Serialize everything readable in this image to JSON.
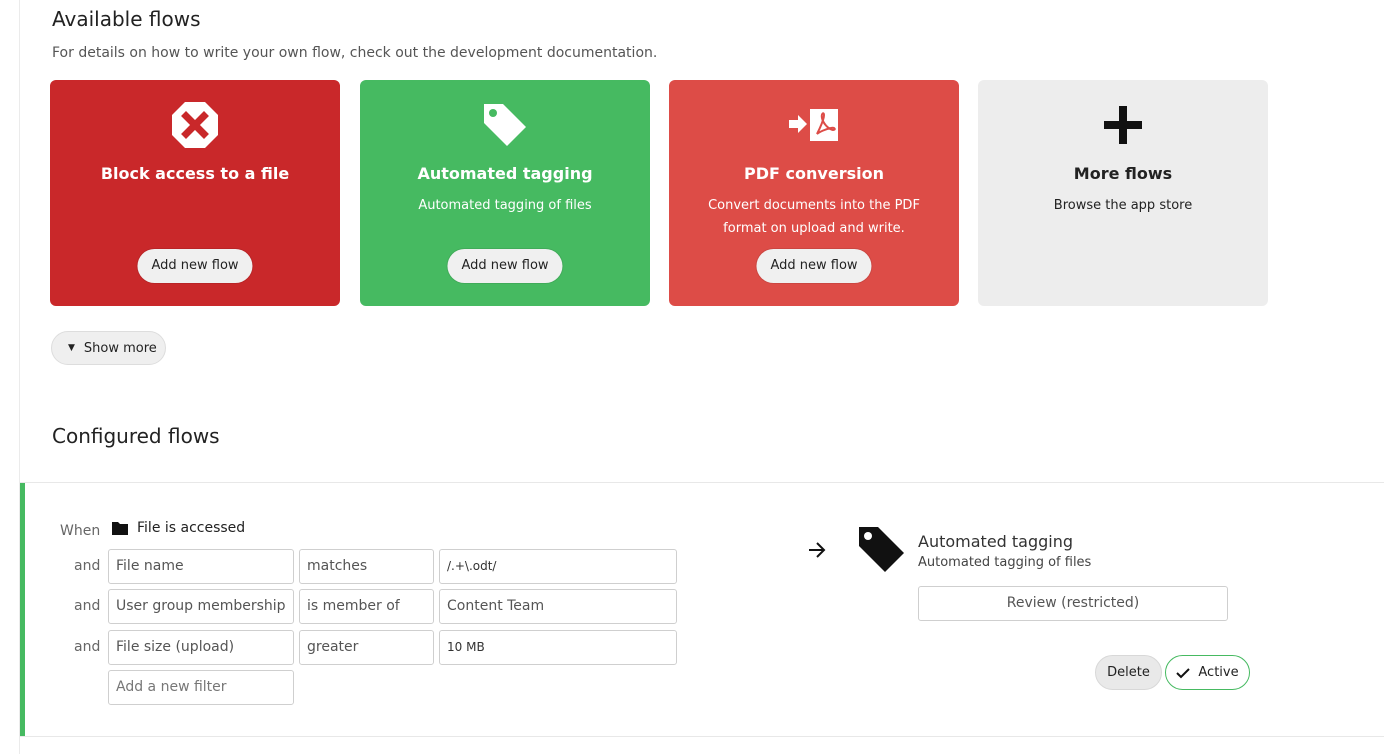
{
  "available": {
    "title": "Available flows",
    "subtitle": "For details on how to write your own flow, check out the development documentation.",
    "cards": [
      {
        "title": "Block access to a file",
        "description": "",
        "button": "Add new flow",
        "icon": "block-x-icon",
        "color": "#c9282a"
      },
      {
        "title": "Automated tagging",
        "description": "Automated tagging of files",
        "button": "Add new flow",
        "icon": "tag-icon",
        "color": "#46ba61"
      },
      {
        "title": "PDF conversion",
        "description": "Convert documents into the PDF format on upload and write.",
        "button": "Add new flow",
        "icon": "pdf-convert-icon",
        "color": "#dd4c47"
      },
      {
        "title": "More flows",
        "description": "Browse the app store",
        "button": "",
        "icon": "plus-icon",
        "color": "#ededed"
      }
    ],
    "show_more": "Show more"
  },
  "configured": {
    "title": "Configured flows",
    "flow": {
      "accent": "#46ba61",
      "when_label": "When",
      "trigger": "File is accessed",
      "trigger_icon": "folder-icon",
      "checks": [
        {
          "joiner": "and",
          "field": "File name",
          "operator": "matches",
          "value": "/.+\\.odt/"
        },
        {
          "joiner": "and",
          "field": "User group membership",
          "operator": "is member of",
          "value": "Content Team"
        },
        {
          "joiner": "and",
          "field": "File size (upload)",
          "operator": "greater",
          "value": "10 MB"
        }
      ],
      "add_filter_placeholder": "Add a new filter",
      "operation": {
        "title": "Automated tagging",
        "description": "Automated tagging of files",
        "tag_selected": "Review (restricted)",
        "icon": "tag-icon"
      },
      "delete_label": "Delete",
      "active_label": "Active"
    }
  }
}
